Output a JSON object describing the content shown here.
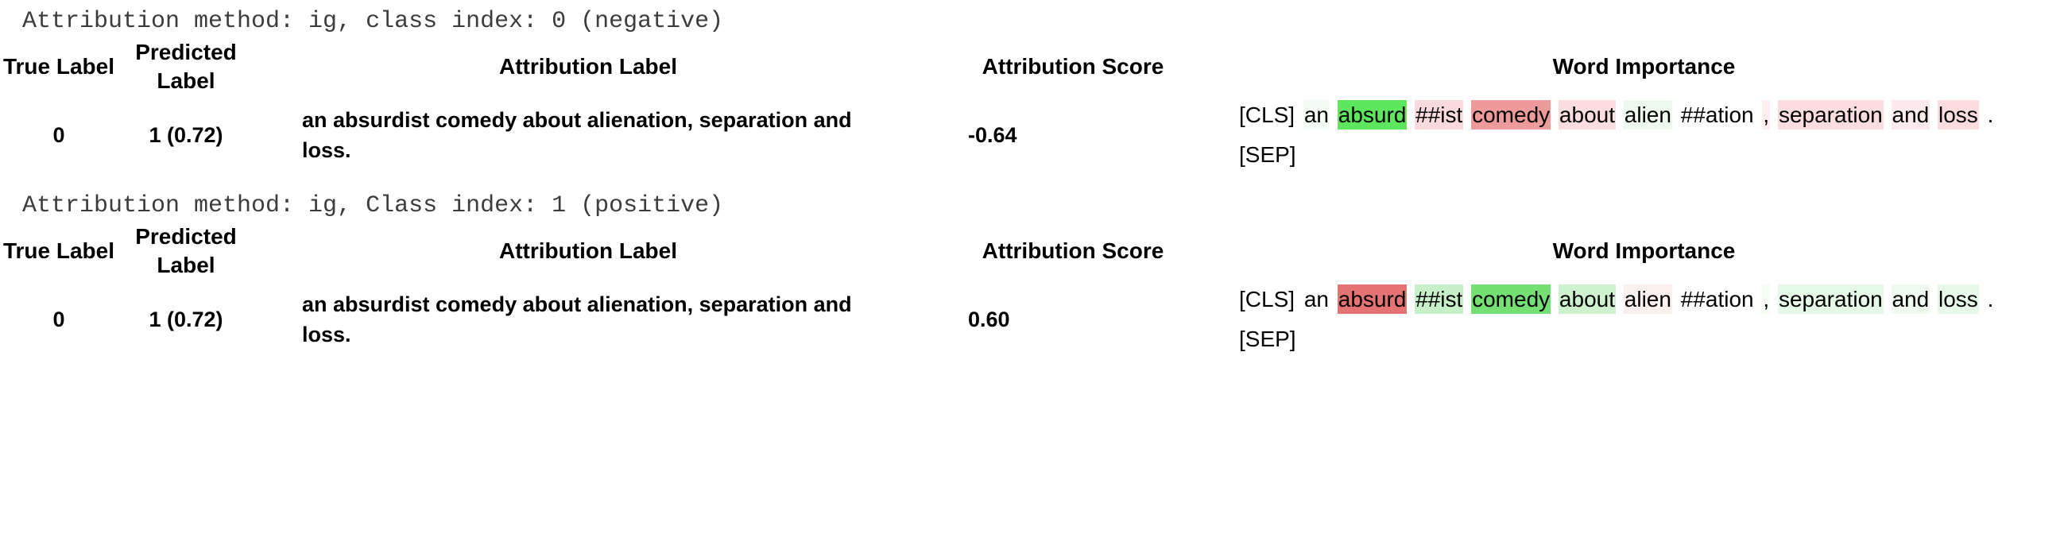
{
  "blocks": [
    {
      "method_line": "Attribution method: ig, class index: 0 (negative)",
      "headers": {
        "true_label": "True Label",
        "predicted_label": "Predicted Label",
        "attribution_label": "Attribution Label",
        "attribution_score": "Attribution Score",
        "word_importance": "Word Importance"
      },
      "row": {
        "true_label": "0",
        "predicted_label": "1 (0.72)",
        "attribution_label": "an absurdist comedy about alienation, separation and loss.",
        "attribution_score": "-0.64"
      },
      "word_importance": [
        {
          "text": "[CLS]",
          "color": "#ffffff"
        },
        {
          "text": "an",
          "color": "#f5fbf5"
        },
        {
          "text": "absurd",
          "color": "#5ce75c"
        },
        {
          "text": "##ist",
          "color": "#fadadd"
        },
        {
          "text": "comedy",
          "color": "#ef9a9a"
        },
        {
          "text": "about",
          "color": "#fbdde0"
        },
        {
          "text": "alien",
          "color": "#edfaed"
        },
        {
          "text": "##ation",
          "color": "#ffffff"
        },
        {
          "text": ",",
          "color": "#fdeff0"
        },
        {
          "text": "separation",
          "color": "#fbdde0"
        },
        {
          "text": "and",
          "color": "#fdeaec"
        },
        {
          "text": "loss",
          "color": "#fbdde0"
        },
        {
          "text": ".",
          "color": "#ffffff"
        },
        {
          "text": "[SEP]",
          "color": "#ffffff"
        }
      ]
    },
    {
      "method_line": "Attribution method: ig, Class index: 1 (positive)",
      "headers": {
        "true_label": "True Label",
        "predicted_label": "Predicted Label",
        "attribution_label": "Attribution Label",
        "attribution_score": "Attribution Score",
        "word_importance": "Word Importance"
      },
      "row": {
        "true_label": "0",
        "predicted_label": "1 (0.72)",
        "attribution_label": "an absurdist comedy about alienation, separation and loss.",
        "attribution_score": "0.60"
      },
      "word_importance": [
        {
          "text": "[CLS]",
          "color": "#ffffff"
        },
        {
          "text": "an",
          "color": "#ffffff"
        },
        {
          "text": "absurd",
          "color": "#e57373"
        },
        {
          "text": "##ist",
          "color": "#c8f0c8"
        },
        {
          "text": "comedy",
          "color": "#74e074"
        },
        {
          "text": "about",
          "color": "#cdf2cd"
        },
        {
          "text": "alien",
          "color": "#fcf0ef"
        },
        {
          "text": "##ation",
          "color": "#ffffff"
        },
        {
          "text": ",",
          "color": "#f4fcf4"
        },
        {
          "text": "separation",
          "color": "#e6f8e6"
        },
        {
          "text": "and",
          "color": "#eefbee"
        },
        {
          "text": "loss",
          "color": "#e9f9e9"
        },
        {
          "text": ".",
          "color": "#ffffff"
        },
        {
          "text": "[SEP]",
          "color": "#ffffff"
        }
      ]
    }
  ]
}
